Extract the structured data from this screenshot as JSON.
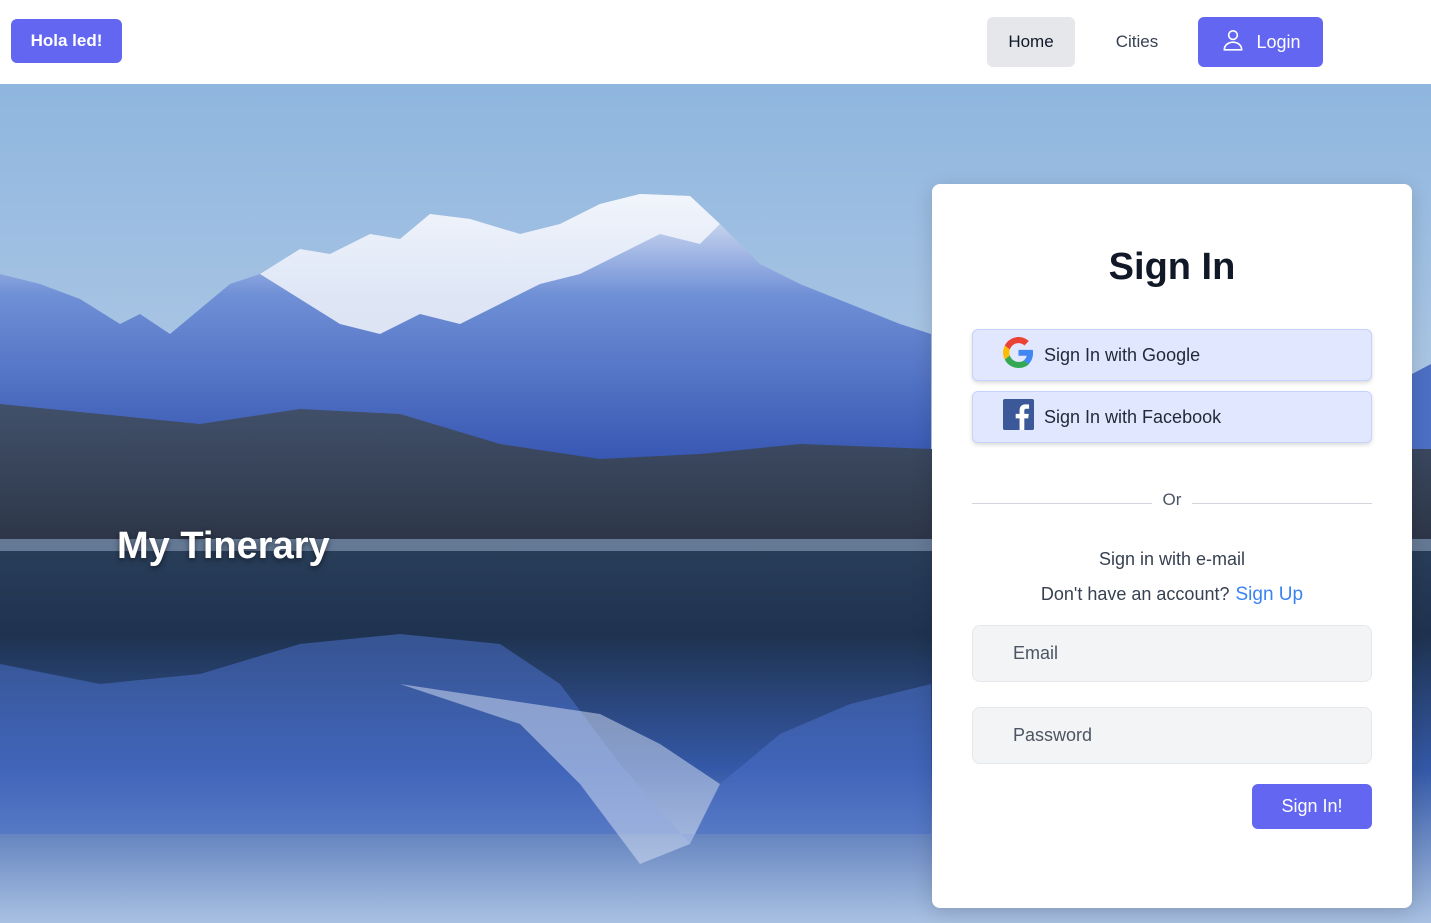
{
  "header": {
    "greeting": "Hola led!",
    "nav": {
      "home": "Home",
      "cities": "Cities"
    },
    "login_label": "Login",
    "login_icon": "user-icon"
  },
  "hero": {
    "title": "My Tinerary",
    "background": "snowy-mountain-lake-reflection"
  },
  "signin": {
    "title": "Sign In",
    "google_label": "Sign In with Google",
    "google_icon": "google-icon",
    "facebook_label": "Sign In with Facebook",
    "facebook_icon": "facebook-icon",
    "divider_text": "Or",
    "email_note": "Sign in with e-mail",
    "account_prompt": "Don't have an account?",
    "signup_link": "Sign Up",
    "email": {
      "placeholder": "Email",
      "value": ""
    },
    "password": {
      "placeholder": "Password",
      "value": ""
    },
    "submit_label": "Sign In!"
  },
  "colors": {
    "accent": "#6366f1",
    "link": "#3b82f6",
    "social_button_bg": "#e0e7ff",
    "nav_active_bg": "#e5e7eb"
  }
}
